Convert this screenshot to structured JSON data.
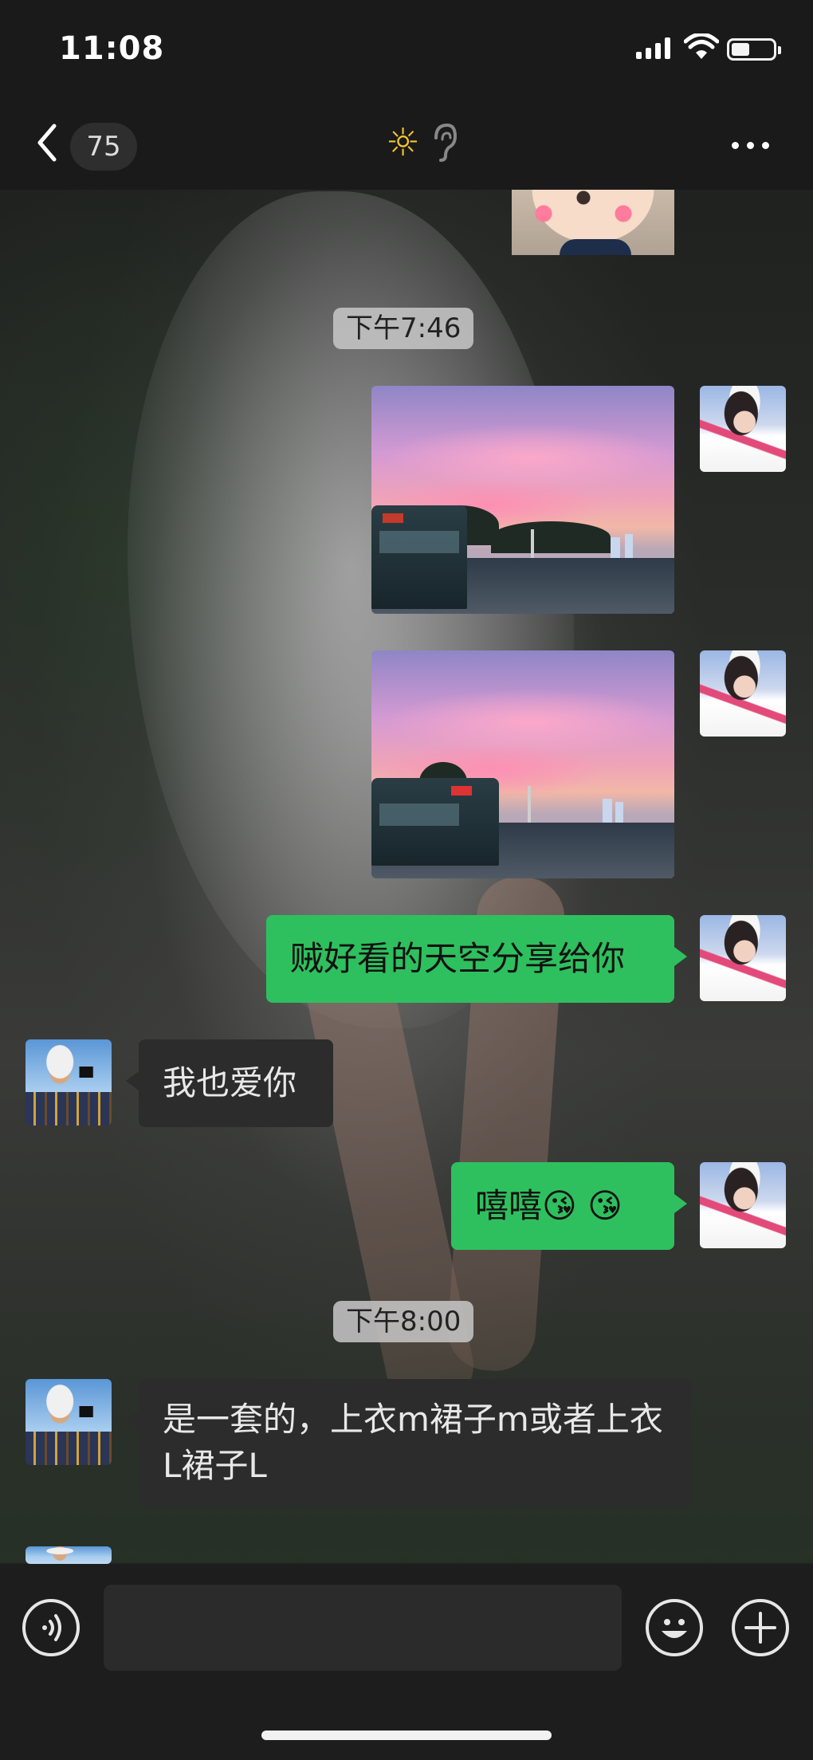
{
  "status_bar": {
    "time": "11:08"
  },
  "nav": {
    "unread_count": "75",
    "status_icon": "sun-icon",
    "mode_icon": "ear-icon"
  },
  "messages": [
    {
      "type": "image",
      "sender": "me",
      "note": "partially visible photo above"
    },
    {
      "type": "timestamp",
      "text": "下午7:46"
    },
    {
      "type": "image",
      "sender": "me",
      "description_icon": "sunset-photo"
    },
    {
      "type": "image",
      "sender": "me",
      "description_icon": "sunset-photo"
    },
    {
      "type": "text",
      "sender": "me",
      "text": "贼好看的天空分享给你"
    },
    {
      "type": "text",
      "sender": "peer",
      "text": "我也爱你"
    },
    {
      "type": "text",
      "sender": "me",
      "text": "嘻嘻😘 😘"
    },
    {
      "type": "timestamp",
      "text": "下午8:00"
    },
    {
      "type": "text",
      "sender": "peer",
      "text": "是一套的，上衣m裙子m或者上衣L裙子L"
    }
  ],
  "input": {
    "value": ""
  },
  "colors": {
    "my_bubble": "#2ec05e",
    "peer_bubble": "#2c2c2c",
    "bar_background": "#1a1a1a"
  }
}
